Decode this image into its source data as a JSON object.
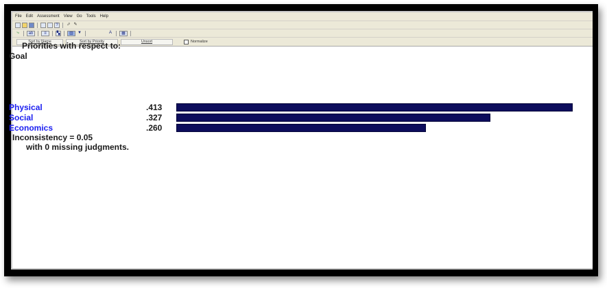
{
  "menu": [
    "File",
    "Edit",
    "Assessment",
    "View",
    "Go",
    "Tools",
    "Help"
  ],
  "toolbar": {
    "row1": [
      "new-icon",
      "open-icon",
      "save-icon",
      "print-icon",
      "preview-icon",
      "help-icon",
      "cursor-icon",
      "graph-icon"
    ],
    "row2": [
      "nodes-icon",
      "abc-icon",
      "compare-icon",
      "sensitivity-icon",
      "filter-icon",
      "font-icon",
      "grid-icon"
    ]
  },
  "sortbar": {
    "sort_name": "Sort by Name",
    "sort_priority": "Sort by Priority",
    "unsort": "Unsort",
    "normalize": "Normalize"
  },
  "heading": {
    "line1": "Priorities with respect to:",
    "line2": "Goal"
  },
  "priorities": [
    {
      "label": "Physical",
      "value": ".413",
      "weight": 0.413
    },
    {
      "label": "Social",
      "value": ".327",
      "weight": 0.327
    },
    {
      "label": "Economics",
      "value": ".260",
      "weight": 0.26
    }
  ],
  "footer": {
    "inconsistency": "Inconsistency = 0.05",
    "missing": "with 0  missing judgments."
  },
  "colors": {
    "bar": "#0d0d5c",
    "label": "#1a1ef0"
  }
}
